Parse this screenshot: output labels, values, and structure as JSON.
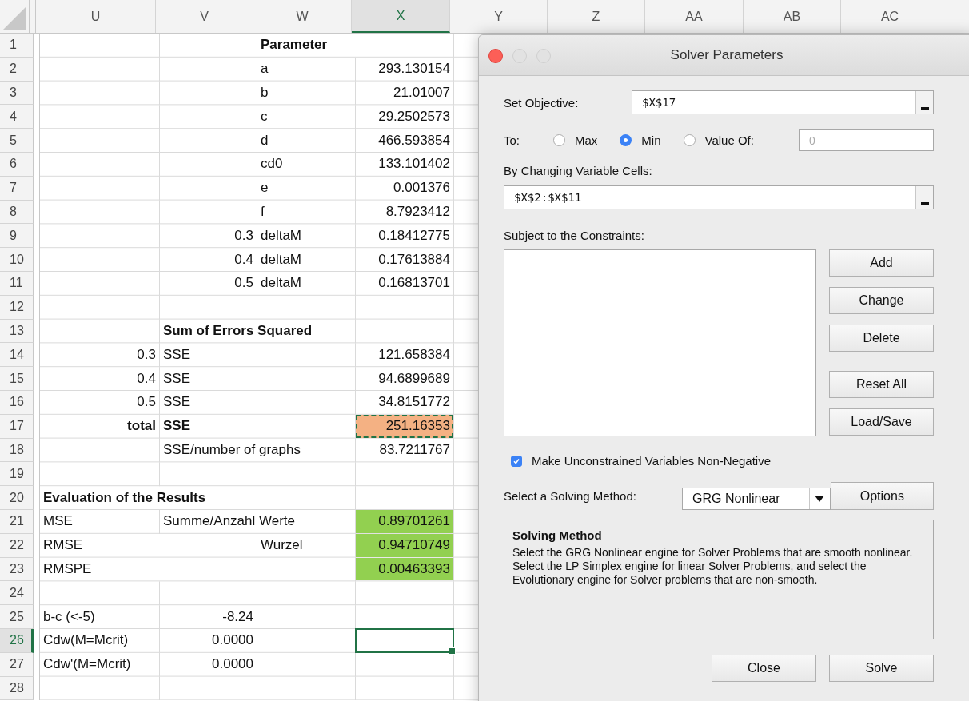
{
  "sheet": {
    "columns": [
      {
        "label": "U",
        "selected": false
      },
      {
        "label": "V",
        "selected": false
      },
      {
        "label": "W",
        "selected": false
      },
      {
        "label": "X",
        "selected": true
      },
      {
        "label": "Y",
        "selected": false
      },
      {
        "label": "Z",
        "selected": false
      },
      {
        "label": "AA",
        "selected": false
      },
      {
        "label": "AB",
        "selected": false
      },
      {
        "label": "AC",
        "selected": false
      }
    ],
    "rows": [
      {
        "number": "1",
        "selected": false,
        "cells": [
          null,
          null,
          {
            "text": "Parameter",
            "kind": "label",
            "bold": true,
            "selected": false,
            "marked": false
          }
        ]
      },
      {
        "number": "2",
        "selected": false,
        "cells": [
          null,
          null,
          {
            "text": "a",
            "kind": "label",
            "bold": false,
            "selected": false,
            "marked": false
          },
          {
            "text": "293.130154",
            "kind": "value",
            "bold": false,
            "selected": false,
            "marked": false
          }
        ]
      },
      {
        "number": "3",
        "selected": false,
        "cells": [
          null,
          null,
          {
            "text": "b",
            "kind": "label",
            "bold": false,
            "selected": false,
            "marked": false
          },
          {
            "text": "21.01007",
            "kind": "value",
            "bold": false,
            "selected": false,
            "marked": false
          }
        ]
      },
      {
        "number": "4",
        "selected": false,
        "cells": [
          null,
          null,
          {
            "text": "c",
            "kind": "label",
            "bold": false,
            "selected": false,
            "marked": false
          },
          {
            "text": "29.2502573",
            "kind": "value",
            "bold": false,
            "selected": false,
            "marked": false
          }
        ]
      },
      {
        "number": "5",
        "selected": false,
        "cells": [
          null,
          null,
          {
            "text": "d",
            "kind": "label",
            "bold": false,
            "selected": false,
            "marked": false
          },
          {
            "text": "466.593854",
            "kind": "value",
            "bold": false,
            "selected": false,
            "marked": false
          }
        ]
      },
      {
        "number": "6",
        "selected": false,
        "cells": [
          null,
          null,
          {
            "text": "cd0",
            "kind": "label",
            "bold": false,
            "selected": false,
            "marked": false
          },
          {
            "text": "133.101402",
            "kind": "value",
            "bold": false,
            "selected": false,
            "marked": false
          }
        ]
      },
      {
        "number": "7",
        "selected": false,
        "cells": [
          null,
          null,
          {
            "text": "e",
            "kind": "label",
            "bold": false,
            "selected": false,
            "marked": false
          },
          {
            "text": "0.001376",
            "kind": "value",
            "bold": false,
            "selected": false,
            "marked": false
          }
        ]
      },
      {
        "number": "8",
        "selected": false,
        "cells": [
          null,
          null,
          {
            "text": "f",
            "kind": "label",
            "bold": false,
            "selected": false,
            "marked": false
          },
          {
            "text": "8.7923412",
            "kind": "value",
            "bold": false,
            "selected": false,
            "marked": false
          }
        ]
      },
      {
        "number": "9",
        "selected": false,
        "cells": [
          null,
          {
            "text": "0.3",
            "kind": "value",
            "bold": false,
            "selected": false,
            "marked": false
          },
          {
            "text": "deltaM",
            "kind": "label",
            "bold": false,
            "selected": false,
            "marked": false
          },
          {
            "text": "0.18412775",
            "kind": "value",
            "bold": false,
            "selected": false,
            "marked": false
          }
        ]
      },
      {
        "number": "10",
        "selected": false,
        "cells": [
          null,
          {
            "text": "0.4",
            "kind": "value",
            "bold": false,
            "selected": false,
            "marked": false
          },
          {
            "text": "deltaM",
            "kind": "label",
            "bold": false,
            "selected": false,
            "marked": false
          },
          {
            "text": "0.17613884",
            "kind": "value",
            "bold": false,
            "selected": false,
            "marked": false
          }
        ]
      },
      {
        "number": "11",
        "selected": false,
        "cells": [
          null,
          {
            "text": "0.5",
            "kind": "value",
            "bold": false,
            "selected": false,
            "marked": false
          },
          {
            "text": "deltaM",
            "kind": "label",
            "bold": false,
            "selected": false,
            "marked": false
          },
          {
            "text": "0.16813701",
            "kind": "value",
            "bold": false,
            "selected": false,
            "marked": false
          }
        ]
      },
      {
        "number": "12",
        "selected": false,
        "cells": []
      },
      {
        "number": "13",
        "selected": false,
        "cells": [
          null,
          {
            "text": "Sum of Errors Squared",
            "kind": "label",
            "bold": true,
            "selected": false,
            "marked": false
          }
        ]
      },
      {
        "number": "14",
        "selected": false,
        "cells": [
          {
            "text": "0.3",
            "kind": "value",
            "bold": false,
            "selected": false,
            "marked": false
          },
          {
            "text": "SSE",
            "kind": "label",
            "bold": false,
            "selected": false,
            "marked": false
          },
          null,
          {
            "text": "121.658384",
            "kind": "value",
            "bold": false,
            "selected": false,
            "marked": false
          }
        ]
      },
      {
        "number": "15",
        "selected": false,
        "cells": [
          {
            "text": "0.4",
            "kind": "value",
            "bold": false,
            "selected": false,
            "marked": false
          },
          {
            "text": "SSE",
            "kind": "label",
            "bold": false,
            "selected": false,
            "marked": false
          },
          null,
          {
            "text": "94.6899689",
            "kind": "value",
            "bold": false,
            "selected": false,
            "marked": false
          }
        ]
      },
      {
        "number": "16",
        "selected": false,
        "cells": [
          {
            "text": "0.5",
            "kind": "value",
            "bold": false,
            "selected": false,
            "marked": false
          },
          {
            "text": "SSE",
            "kind": "label",
            "bold": false,
            "selected": false,
            "marked": false
          },
          null,
          {
            "text": "34.8151772",
            "kind": "value",
            "bold": false,
            "selected": false,
            "marked": false
          }
        ]
      },
      {
        "number": "17",
        "selected": false,
        "cells": [
          {
            "text": "total",
            "kind": "value",
            "bold": true,
            "selected": false,
            "marked": false
          },
          {
            "text": "SSE",
            "kind": "label",
            "bold": true,
            "selected": false,
            "marked": false
          },
          null,
          {
            "text": "251.16353",
            "kind": "value",
            "bold": false,
            "selected": false,
            "marked": true,
            "color": "#f4b183"
          }
        ]
      },
      {
        "number": "18",
        "selected": false,
        "cells": [
          null,
          {
            "text": "SSE/number of graphs",
            "kind": "label",
            "bold": false,
            "selected": false,
            "marked": false
          },
          null,
          {
            "text": "83.7211767",
            "kind": "value",
            "bold": false,
            "selected": false,
            "marked": false
          }
        ]
      },
      {
        "number": "19",
        "selected": false,
        "cells": []
      },
      {
        "number": "20",
        "selected": false,
        "cells": [
          {
            "text": "Evaluation of the Results",
            "kind": "label",
            "bold": true,
            "selected": false,
            "marked": false
          }
        ]
      },
      {
        "number": "21",
        "selected": false,
        "cells": [
          {
            "text": "MSE",
            "kind": "label",
            "bold": false,
            "selected": false,
            "marked": false
          },
          {
            "text": "Summe/Anzahl Werte",
            "kind": "label",
            "bold": false,
            "selected": false,
            "marked": false
          },
          null,
          {
            "text": "0.89701261",
            "kind": "value",
            "bold": false,
            "selected": false,
            "marked": false,
            "color": "#92d050"
          }
        ]
      },
      {
        "number": "22",
        "selected": false,
        "cells": [
          {
            "text": "RMSE",
            "kind": "label",
            "bold": false,
            "selected": false,
            "marked": false
          },
          null,
          {
            "text": "Wurzel",
            "kind": "label",
            "bold": false,
            "selected": false,
            "marked": false
          },
          {
            "text": "0.94710749",
            "kind": "value",
            "bold": false,
            "selected": false,
            "marked": false,
            "color": "#92d050"
          }
        ]
      },
      {
        "number": "23",
        "selected": false,
        "cells": [
          {
            "text": "RMSPE",
            "kind": "label",
            "bold": false,
            "selected": false,
            "marked": false
          },
          null,
          null,
          {
            "text": "0.00463393",
            "kind": "value",
            "bold": false,
            "selected": false,
            "marked": false,
            "color": "#92d050"
          }
        ]
      },
      {
        "number": "24",
        "selected": false,
        "cells": []
      },
      {
        "number": "25",
        "selected": false,
        "cells": [
          {
            "text": "b-c (<-5)",
            "kind": "label",
            "bold": false,
            "selected": false,
            "marked": false
          },
          {
            "text": "-8.24",
            "kind": "value",
            "bold": false,
            "selected": false,
            "marked": false
          }
        ]
      },
      {
        "number": "26",
        "selected": true,
        "cells": [
          {
            "text": "Cdw(M=Mcrit)",
            "kind": "label",
            "bold": false,
            "selected": false,
            "marked": false
          },
          {
            "text": "0.0000",
            "kind": "value",
            "bold": false,
            "selected": false,
            "marked": false
          },
          null,
          {
            "kind": "blank",
            "bold": false,
            "selected": true,
            "marked": false
          }
        ]
      },
      {
        "number": "27",
        "selected": false,
        "cells": [
          {
            "text": "Cdw'(M=Mcrit)",
            "kind": "label",
            "bold": false,
            "selected": false,
            "marked": false
          },
          {
            "text": "0.0000",
            "kind": "value",
            "bold": false,
            "selected": false,
            "marked": false
          }
        ]
      },
      {
        "number": "28",
        "selected": false,
        "cells": []
      }
    ]
  },
  "dialog": {
    "title": "Solver Parameters",
    "objective": {
      "label": "Set Objective:",
      "value": "$X$17"
    },
    "to": {
      "label": "To:",
      "options": [
        {
          "label": "Max",
          "selected": false
        },
        {
          "label": "Min",
          "selected": true
        },
        {
          "label": "Value Of:",
          "selected": false
        }
      ],
      "value": "0",
      "disabled": true
    },
    "variables": {
      "label": "By Changing Variable Cells:",
      "value": "$X$2:$X$11"
    },
    "constraints": {
      "label": "Subject to the Constraints:"
    },
    "constraint_buttons": [
      "Add",
      "Change",
      "Delete",
      "Reset All",
      "Load/Save"
    ],
    "non_negative": {
      "label": "Make Unconstrained Variables Non-Negative",
      "checked": true
    },
    "method": {
      "label": "Select a Solving Method:",
      "value": "GRG Nonlinear",
      "button": "Options"
    },
    "description": {
      "title": "Solving Method",
      "text": "Select the GRG Nonlinear engine for Solver Problems that are smooth nonlinear. Select the LP Simplex engine for linear Solver Problems, and select the Evolutionary engine for Solver problems that are non-smooth."
    },
    "buttons": [
      "Close",
      "Solve"
    ]
  }
}
